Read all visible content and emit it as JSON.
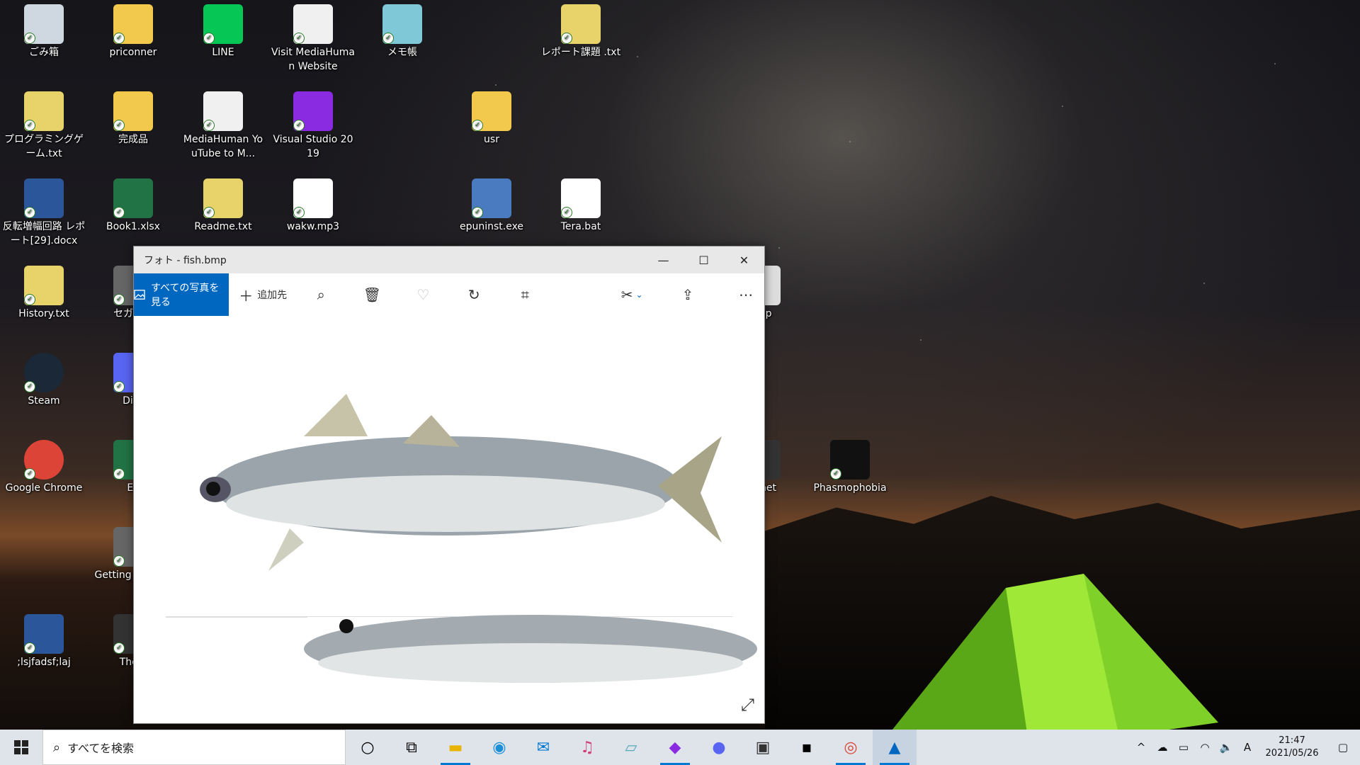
{
  "desktop": {
    "icons": [
      {
        "label": "ごみ箱",
        "icon": "recycle-bin-icon"
      },
      {
        "label": "priconner",
        "icon": "folder-icon"
      },
      {
        "label": "LINE",
        "icon": "line-app-icon"
      },
      {
        "label": "Visit MediaHuman Website",
        "icon": "mediahuman-icon"
      },
      {
        "label": "メモ帳",
        "icon": "notepad-icon"
      },
      {
        "label": "レポート課題 .txt",
        "icon": "text-file-icon"
      },
      {
        "label": "プログラミングゲーム.txt",
        "icon": "text-file-icon"
      },
      {
        "label": "完成品",
        "icon": "folder-icon"
      },
      {
        "label": "MediaHuman YouTube to M...",
        "icon": "mediahuman-icon"
      },
      {
        "label": "Visual Studio 2019",
        "icon": "visual-studio-icon"
      },
      {
        "label": "usr",
        "icon": "folder-icon"
      },
      {
        "label": "反転増幅回路 レポート[29].docx",
        "icon": "word-doc-icon"
      },
      {
        "label": "Book1.xlsx",
        "icon": "excel-icon"
      },
      {
        "label": "Readme.txt",
        "icon": "text-file-icon"
      },
      {
        "label": "wakw.mp3",
        "icon": "audio-file-icon"
      },
      {
        "label": "epuninst.exe",
        "icon": "installer-icon"
      },
      {
        "label": "Tera.bat",
        "icon": "batch-file-icon"
      },
      {
        "label": "History.txt",
        "icon": "text-file-icon"
      },
      {
        "label": "セガNET",
        "icon": "app-icon"
      },
      {
        "label": "omp",
        "icon": "image-file-icon"
      },
      {
        "label": "Steam",
        "icon": "steam-icon"
      },
      {
        "label": "Disc",
        "icon": "discord-icon"
      },
      {
        "label": "Google Chrome",
        "icon": "chrome-icon"
      },
      {
        "label": "Ex",
        "icon": "excel-icon"
      },
      {
        "label": "Planet",
        "icon": "game-icon"
      },
      {
        "label": "Phasmophobia",
        "icon": "phasmophobia-icon"
      },
      {
        "label": "Getting with Be",
        "icon": "app-icon"
      },
      {
        "label": ";lsjfadsf;laj",
        "icon": "word-doc-icon"
      },
      {
        "label": "The F",
        "icon": "game-icon"
      }
    ]
  },
  "photos_window": {
    "title": "フォト - fish.bmp",
    "all_photos_label": "すべての写真を見る",
    "add_to_label": "追加先",
    "minimize_icon": "minimize-icon",
    "maximize_icon": "maximize-icon",
    "close_icon": "close-icon"
  },
  "taskbar": {
    "search_placeholder": "すべてを検索",
    "ime": "A",
    "time": "21:47",
    "date": "2021/05/26"
  },
  "colors": {
    "accent": "#0067c0",
    "taskbar_bg": "#dfe3ea"
  }
}
